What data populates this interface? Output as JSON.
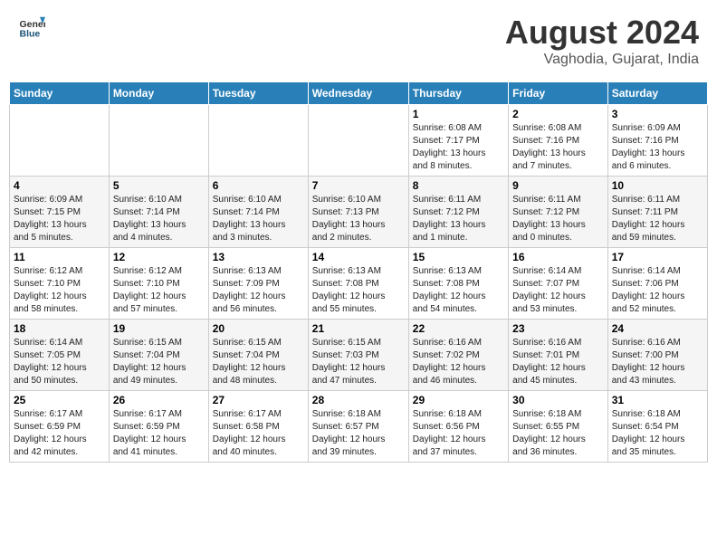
{
  "header": {
    "logo_general": "General",
    "logo_blue": "Blue",
    "title": "August 2024",
    "subtitle": "Vaghodia, Gujarat, India"
  },
  "calendar": {
    "days_of_week": [
      "Sunday",
      "Monday",
      "Tuesday",
      "Wednesday",
      "Thursday",
      "Friday",
      "Saturday"
    ],
    "weeks": [
      [
        {
          "day": "",
          "info": ""
        },
        {
          "day": "",
          "info": ""
        },
        {
          "day": "",
          "info": ""
        },
        {
          "day": "",
          "info": ""
        },
        {
          "day": "1",
          "info": "Sunrise: 6:08 AM\nSunset: 7:17 PM\nDaylight: 13 hours\nand 8 minutes."
        },
        {
          "day": "2",
          "info": "Sunrise: 6:08 AM\nSunset: 7:16 PM\nDaylight: 13 hours\nand 7 minutes."
        },
        {
          "day": "3",
          "info": "Sunrise: 6:09 AM\nSunset: 7:16 PM\nDaylight: 13 hours\nand 6 minutes."
        }
      ],
      [
        {
          "day": "4",
          "info": "Sunrise: 6:09 AM\nSunset: 7:15 PM\nDaylight: 13 hours\nand 5 minutes."
        },
        {
          "day": "5",
          "info": "Sunrise: 6:10 AM\nSunset: 7:14 PM\nDaylight: 13 hours\nand 4 minutes."
        },
        {
          "day": "6",
          "info": "Sunrise: 6:10 AM\nSunset: 7:14 PM\nDaylight: 13 hours\nand 3 minutes."
        },
        {
          "day": "7",
          "info": "Sunrise: 6:10 AM\nSunset: 7:13 PM\nDaylight: 13 hours\nand 2 minutes."
        },
        {
          "day": "8",
          "info": "Sunrise: 6:11 AM\nSunset: 7:12 PM\nDaylight: 13 hours\nand 1 minute."
        },
        {
          "day": "9",
          "info": "Sunrise: 6:11 AM\nSunset: 7:12 PM\nDaylight: 13 hours\nand 0 minutes."
        },
        {
          "day": "10",
          "info": "Sunrise: 6:11 AM\nSunset: 7:11 PM\nDaylight: 12 hours\nand 59 minutes."
        }
      ],
      [
        {
          "day": "11",
          "info": "Sunrise: 6:12 AM\nSunset: 7:10 PM\nDaylight: 12 hours\nand 58 minutes."
        },
        {
          "day": "12",
          "info": "Sunrise: 6:12 AM\nSunset: 7:10 PM\nDaylight: 12 hours\nand 57 minutes."
        },
        {
          "day": "13",
          "info": "Sunrise: 6:13 AM\nSunset: 7:09 PM\nDaylight: 12 hours\nand 56 minutes."
        },
        {
          "day": "14",
          "info": "Sunrise: 6:13 AM\nSunset: 7:08 PM\nDaylight: 12 hours\nand 55 minutes."
        },
        {
          "day": "15",
          "info": "Sunrise: 6:13 AM\nSunset: 7:08 PM\nDaylight: 12 hours\nand 54 minutes."
        },
        {
          "day": "16",
          "info": "Sunrise: 6:14 AM\nSunset: 7:07 PM\nDaylight: 12 hours\nand 53 minutes."
        },
        {
          "day": "17",
          "info": "Sunrise: 6:14 AM\nSunset: 7:06 PM\nDaylight: 12 hours\nand 52 minutes."
        }
      ],
      [
        {
          "day": "18",
          "info": "Sunrise: 6:14 AM\nSunset: 7:05 PM\nDaylight: 12 hours\nand 50 minutes."
        },
        {
          "day": "19",
          "info": "Sunrise: 6:15 AM\nSunset: 7:04 PM\nDaylight: 12 hours\nand 49 minutes."
        },
        {
          "day": "20",
          "info": "Sunrise: 6:15 AM\nSunset: 7:04 PM\nDaylight: 12 hours\nand 48 minutes."
        },
        {
          "day": "21",
          "info": "Sunrise: 6:15 AM\nSunset: 7:03 PM\nDaylight: 12 hours\nand 47 minutes."
        },
        {
          "day": "22",
          "info": "Sunrise: 6:16 AM\nSunset: 7:02 PM\nDaylight: 12 hours\nand 46 minutes."
        },
        {
          "day": "23",
          "info": "Sunrise: 6:16 AM\nSunset: 7:01 PM\nDaylight: 12 hours\nand 45 minutes."
        },
        {
          "day": "24",
          "info": "Sunrise: 6:16 AM\nSunset: 7:00 PM\nDaylight: 12 hours\nand 43 minutes."
        }
      ],
      [
        {
          "day": "25",
          "info": "Sunrise: 6:17 AM\nSunset: 6:59 PM\nDaylight: 12 hours\nand 42 minutes."
        },
        {
          "day": "26",
          "info": "Sunrise: 6:17 AM\nSunset: 6:59 PM\nDaylight: 12 hours\nand 41 minutes."
        },
        {
          "day": "27",
          "info": "Sunrise: 6:17 AM\nSunset: 6:58 PM\nDaylight: 12 hours\nand 40 minutes."
        },
        {
          "day": "28",
          "info": "Sunrise: 6:18 AM\nSunset: 6:57 PM\nDaylight: 12 hours\nand 39 minutes."
        },
        {
          "day": "29",
          "info": "Sunrise: 6:18 AM\nSunset: 6:56 PM\nDaylight: 12 hours\nand 37 minutes."
        },
        {
          "day": "30",
          "info": "Sunrise: 6:18 AM\nSunset: 6:55 PM\nDaylight: 12 hours\nand 36 minutes."
        },
        {
          "day": "31",
          "info": "Sunrise: 6:18 AM\nSunset: 6:54 PM\nDaylight: 12 hours\nand 35 minutes."
        }
      ]
    ]
  }
}
